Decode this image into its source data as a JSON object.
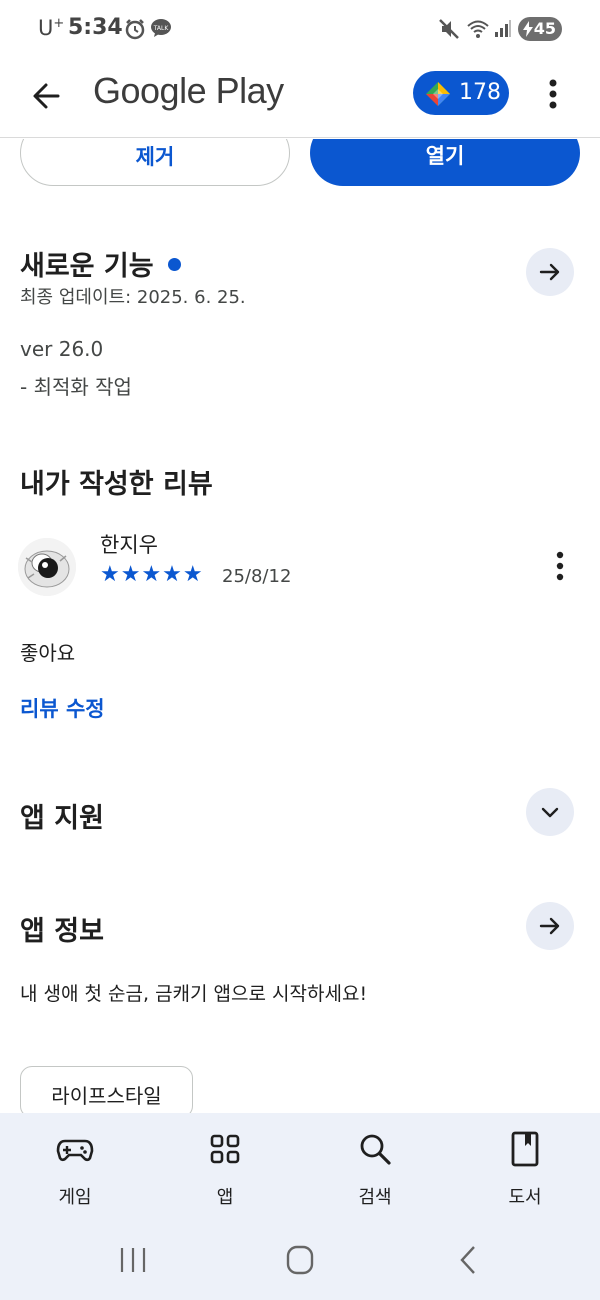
{
  "status_bar": {
    "carrier": "U",
    "carrier_sup": "+",
    "time": "5:34",
    "battery": "45",
    "icons": [
      "alarm-icon",
      "talk-icon",
      "mute-icon",
      "wifi-icon",
      "signal-icon",
      "battery-icon"
    ]
  },
  "app_bar": {
    "title": "Google Play",
    "points": "178"
  },
  "install_actions": {
    "remove_label": "제거",
    "open_label": "열기"
  },
  "whats_new": {
    "title": "새로운 기능",
    "updated": "최종 업데이트: 2025. 6. 25.",
    "version": "ver 26.0",
    "note": "- 최적화 작업"
  },
  "my_review": {
    "title": "내가 작성한 리뷰",
    "reviewer": "한지우",
    "stars": "★★★★★",
    "rating": 5,
    "date": "25/8/12",
    "text": "좋아요",
    "edit_label": "리뷰 수정"
  },
  "app_support": {
    "title": "앱 지원"
  },
  "app_info": {
    "title": "앱 정보",
    "description": "내 생애 첫 순금, 금캐기 앱으로 시작하세요!",
    "category_chip": "라이프스타일"
  },
  "bottom_nav": {
    "items": [
      {
        "label": "게임",
        "icon": "gamepad-icon"
      },
      {
        "label": "앱",
        "icon": "apps-grid-icon"
      },
      {
        "label": "검색",
        "icon": "search-icon"
      },
      {
        "label": "도서",
        "icon": "book-icon"
      }
    ]
  },
  "colors": {
    "accent": "#0b57d0",
    "nav_bg": "#edf1f9",
    "circle_btn_bg": "#e8ecf5"
  }
}
